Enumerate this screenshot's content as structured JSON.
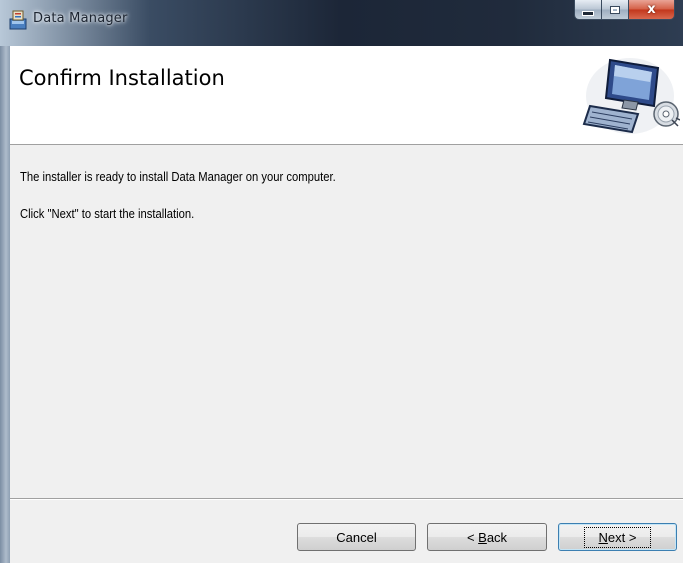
{
  "window": {
    "title": "Data Manager",
    "close_glyph": "x"
  },
  "banner": {
    "title": "Confirm Installation",
    "graphic_icon": "computer-with-disc-icon"
  },
  "content": {
    "line1": "The installer is ready to install Data Manager on your computer.",
    "line2": "Click \"Next\" to start the installation."
  },
  "buttons": {
    "cancel": "Cancel",
    "back_prefix": "< ",
    "back_accel": "B",
    "back_rest": "ack",
    "next_accel": "N",
    "next_rest": "ext >"
  },
  "colors": {
    "titlebar_dark": "#1c2637",
    "close_red": "#c2361b",
    "dialog_bg": "#f0f0f0",
    "banner_bg": "#ffffff",
    "default_button_border": "#3c7fb1"
  }
}
